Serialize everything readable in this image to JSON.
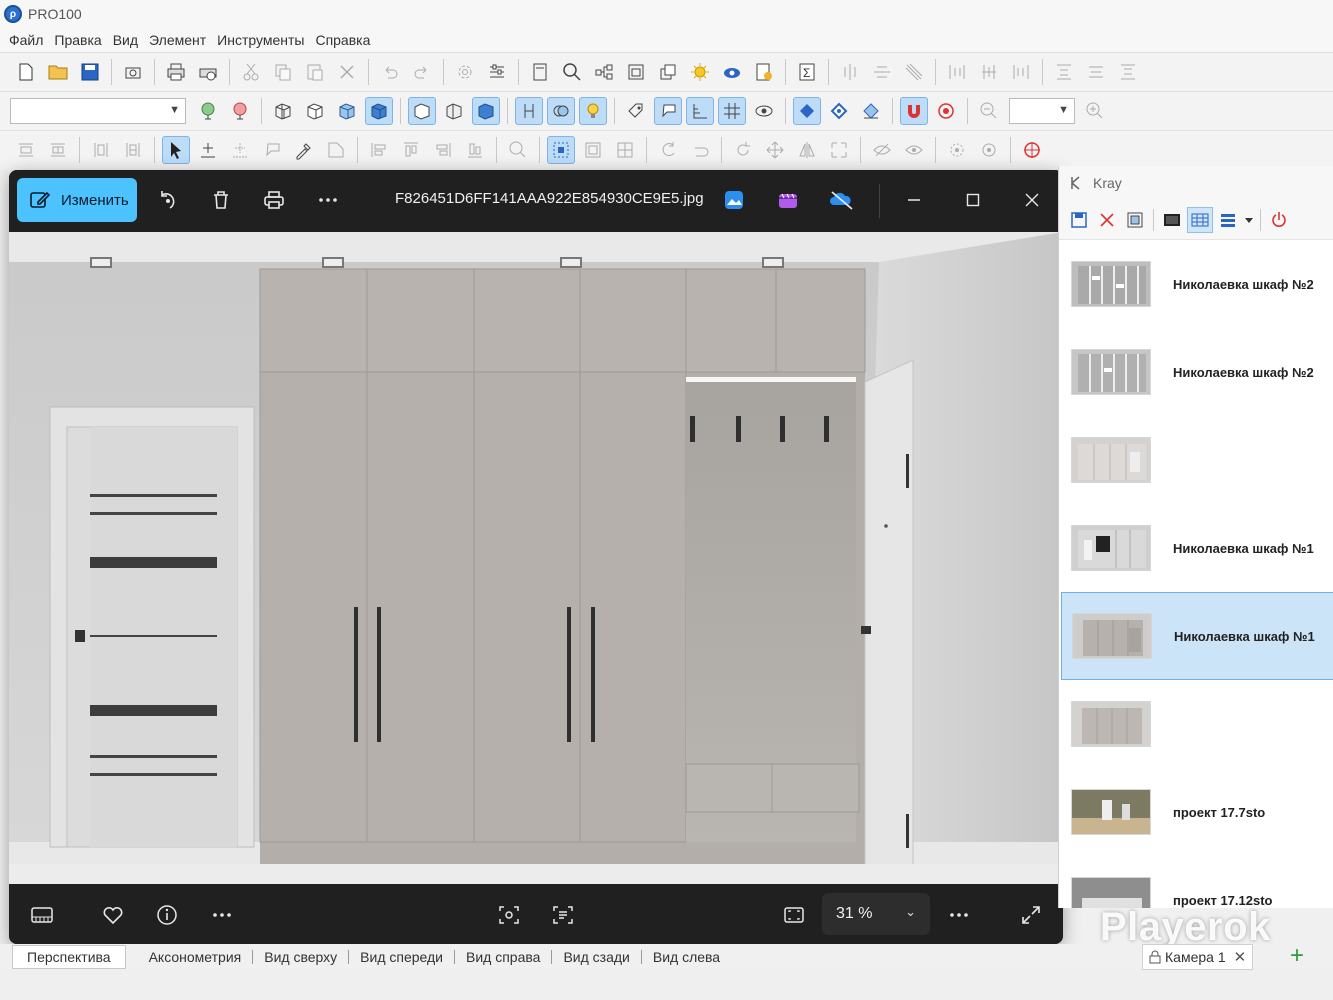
{
  "app": {
    "title": "PRO100"
  },
  "menu": [
    "Файл",
    "Правка",
    "Вид",
    "Элемент",
    "Инструменты",
    "Справка"
  ],
  "viewer": {
    "edit_label": "Изменить",
    "filename": "F826451D6FF141AAA922E854930CE9E5.jpg",
    "zoom": "31 %"
  },
  "kray": {
    "title": "Kray",
    "items": [
      {
        "name": "Николаевка шкаф №2",
        "thumb": "wardrobe-grey"
      },
      {
        "name": "Николаевка шкаф №2",
        "thumb": "wardrobe-grey"
      },
      {
        "name": "",
        "thumb": "wardrobe-light"
      },
      {
        "name": "Николаевка шкаф №1",
        "thumb": "wardrobe-dark"
      },
      {
        "name": "Николаевка шкаф №1",
        "thumb": "wardrobe-beige"
      },
      {
        "name": "",
        "thumb": "wardrobe-beige"
      },
      {
        "name": "проект 17.7sto",
        "thumb": "room-photo"
      },
      {
        "name": "проект 17.12sto",
        "thumb": "room-photo"
      }
    ]
  },
  "tabs": [
    "Перспектива",
    "Аксонометрия",
    "Вид сверху",
    "Вид спереди",
    "Вид справа",
    "Вид сзади",
    "Вид слева"
  ],
  "camera_tab": "Камера 1",
  "watermark": "Playerok",
  "colors": {
    "accent": "#4cc2ff",
    "selection": "#cce4f7",
    "viewer_bg": "#202020"
  }
}
